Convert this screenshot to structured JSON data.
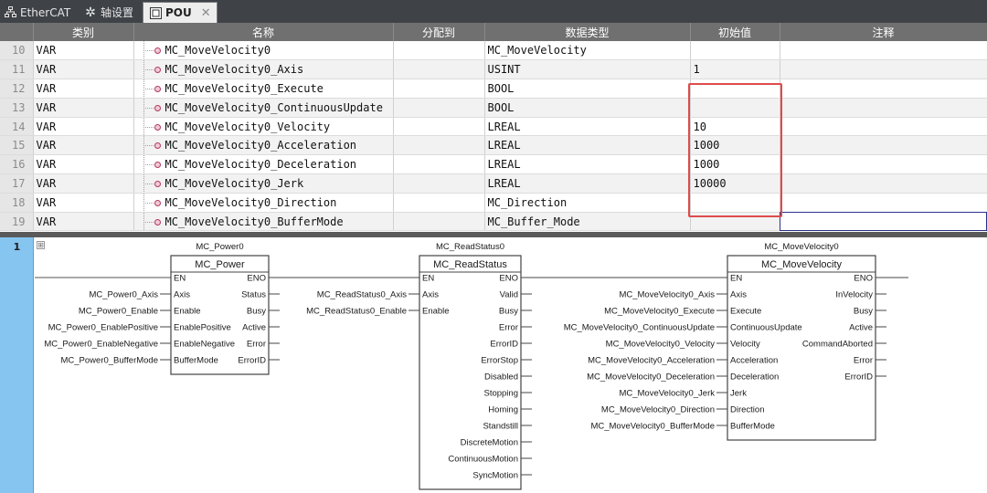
{
  "tabs": [
    {
      "label": "EtherCAT",
      "icon": "network-icon",
      "active": false
    },
    {
      "label": "轴设置",
      "icon": "gear-icon",
      "active": false
    },
    {
      "label": "POU",
      "icon": "pou-icon",
      "active": true
    }
  ],
  "table": {
    "columns": [
      "",
      "类别",
      "名称",
      "分配到",
      "数据类型",
      "初始值",
      "注释"
    ],
    "rows": [
      {
        "num": "10",
        "cat": "VAR",
        "name": "MC_MoveVelocity0",
        "assign": "",
        "type": "MC_MoveVelocity",
        "init": "",
        "comment": ""
      },
      {
        "num": "11",
        "cat": "VAR",
        "name": "MC_MoveVelocity0_Axis",
        "assign": "",
        "type": "USINT",
        "init": "1",
        "comment": ""
      },
      {
        "num": "12",
        "cat": "VAR",
        "name": "MC_MoveVelocity0_Execute",
        "assign": "",
        "type": "BOOL",
        "init": "",
        "comment": ""
      },
      {
        "num": "13",
        "cat": "VAR",
        "name": "MC_MoveVelocity0_ContinuousUpdate",
        "assign": "",
        "type": "BOOL",
        "init": "",
        "comment": ""
      },
      {
        "num": "14",
        "cat": "VAR",
        "name": "MC_MoveVelocity0_Velocity",
        "assign": "",
        "type": "LREAL",
        "init": "10",
        "comment": ""
      },
      {
        "num": "15",
        "cat": "VAR",
        "name": "MC_MoveVelocity0_Acceleration",
        "assign": "",
        "type": "LREAL",
        "init": "1000",
        "comment": ""
      },
      {
        "num": "16",
        "cat": "VAR",
        "name": "MC_MoveVelocity0_Deceleration",
        "assign": "",
        "type": "LREAL",
        "init": "1000",
        "comment": ""
      },
      {
        "num": "17",
        "cat": "VAR",
        "name": "MC_MoveVelocity0_Jerk",
        "assign": "",
        "type": "LREAL",
        "init": "10000",
        "comment": ""
      },
      {
        "num": "18",
        "cat": "VAR",
        "name": "MC_MoveVelocity0_Direction",
        "assign": "",
        "type": "MC_Direction",
        "init": "",
        "comment": ""
      },
      {
        "num": "19",
        "cat": "VAR",
        "name": "MC_MoveVelocity0_BufferMode",
        "assign": "",
        "type": "MC_Buffer_Mode",
        "init": "",
        "comment": ""
      }
    ]
  },
  "rung": {
    "number": "1",
    "expand_glyph": "⊞"
  },
  "blocks": [
    {
      "instance": "MC_Power0",
      "type": "MC_Power",
      "inputs": [
        "EN",
        "Axis",
        "Enable",
        "EnablePositive",
        "EnableNegative",
        "BufferMode"
      ],
      "outputs": [
        "ENO",
        "Status",
        "Busy",
        "Active",
        "Error",
        "ErrorID"
      ],
      "input_vars": [
        "",
        "MC_Power0_Axis",
        "MC_Power0_Enable",
        "MC_Power0_EnablePositive",
        "MC_Power0_EnableNegative",
        "MC_Power0_BufferMode"
      ]
    },
    {
      "instance": "MC_ReadStatus0",
      "type": "MC_ReadStatus",
      "inputs": [
        "EN",
        "Axis",
        "Enable"
      ],
      "outputs": [
        "ENO",
        "Valid",
        "Busy",
        "Error",
        "ErrorID",
        "ErrorStop",
        "Disabled",
        "Stopping",
        "Homing",
        "Standstill",
        "DiscreteMotion",
        "ContinuousMotion",
        "SyncMotion"
      ],
      "input_vars": [
        "",
        "MC_ReadStatus0_Axis",
        "MC_ReadStatus0_Enable"
      ]
    },
    {
      "instance": "MC_MoveVelocity0",
      "type": "MC_MoveVelocity",
      "inputs": [
        "EN",
        "Axis",
        "Execute",
        "ContinuousUpdate",
        "Velocity",
        "Acceleration",
        "Deceleration",
        "Jerk",
        "Direction",
        "BufferMode"
      ],
      "outputs": [
        "ENO",
        "InVelocity",
        "Busy",
        "Active",
        "CommandAborted",
        "Error",
        "ErrorID"
      ],
      "input_vars": [
        "",
        "MC_MoveVelocity0_Axis",
        "MC_MoveVelocity0_Execute",
        "MC_MoveVelocity0_ContinuousUpdate",
        "MC_MoveVelocity0_Velocity",
        "MC_MoveVelocity0_Acceleration",
        "MC_MoveVelocity0_Deceleration",
        "MC_MoveVelocity0_Jerk",
        "MC_MoveVelocity0_Direction",
        "MC_MoveVelocity0_BufferMode"
      ]
    }
  ],
  "colors": {
    "highlight": "#e04a4a",
    "rung_bar": "#86c5f0",
    "header_bg": "#707070"
  }
}
